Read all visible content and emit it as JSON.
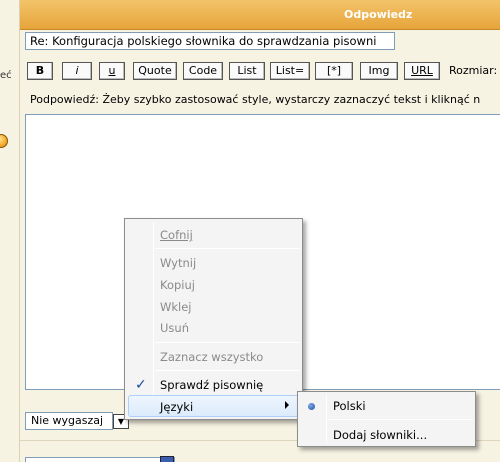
{
  "left": {
    "fragment": "eć"
  },
  "header": {
    "title": "Odpowiedz"
  },
  "subject": {
    "value": "Re: Konfiguracja polskiego słownika do sprawdzania pisowni"
  },
  "toolbar": {
    "buttons": [
      "B",
      "i",
      "u",
      "Quote",
      "Code",
      "List",
      "List=",
      "[*]",
      "Img",
      "URL"
    ],
    "size_label": "Rozmiar:"
  },
  "hint": "Podpowiedź: Żeby szybko zastosować style, wystarczy zaznaczyć tekst i kliknąć n",
  "dropdown": {
    "selected": "Nie wygaszaj"
  },
  "context_menu": {
    "undo": "Cofnij",
    "cut": "Wytnij",
    "copy": "Kopiuj",
    "paste": "Wklej",
    "delete": "Usuń",
    "select_all": "Zaznacz wszystko",
    "spellcheck": "Sprawdź pisownię",
    "languages": "Języki"
  },
  "submenu": {
    "polish": "Polski",
    "add_dictionaries": "Dodaj słowniki..."
  }
}
